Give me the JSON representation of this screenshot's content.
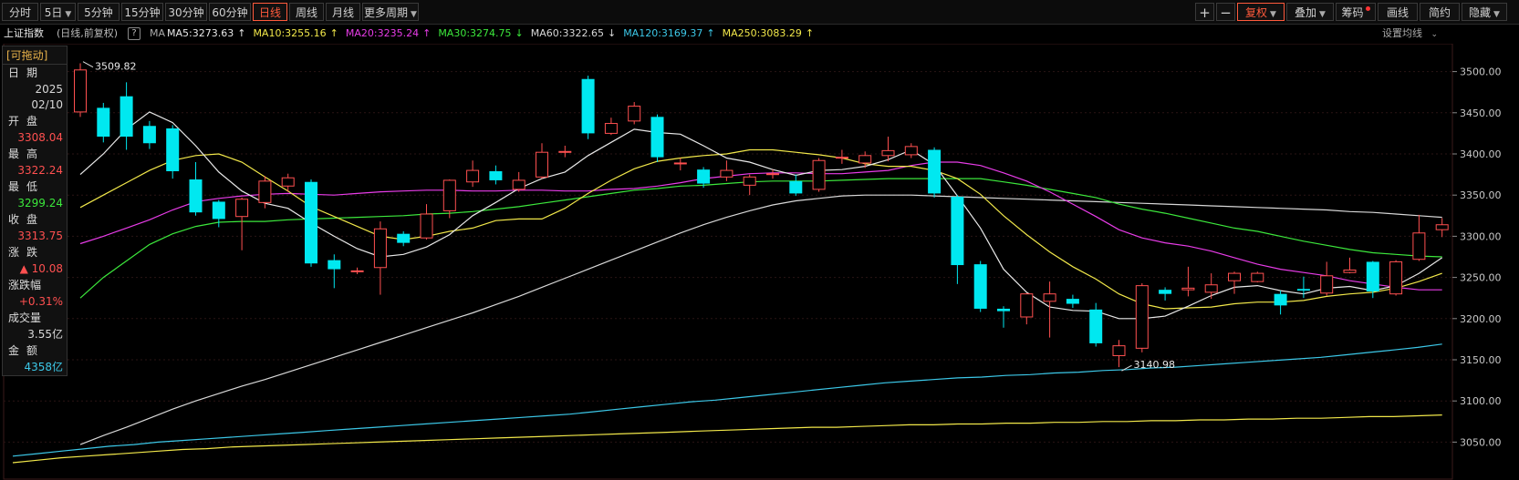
{
  "toolbar": {
    "left_tabs": [
      {
        "label": "分时",
        "active": false,
        "dropdown": false
      },
      {
        "label": "5日",
        "active": false,
        "dropdown": true
      },
      {
        "label": "5分钟",
        "active": false,
        "dropdown": false
      },
      {
        "label": "15分钟",
        "active": false,
        "dropdown": false
      },
      {
        "label": "30分钟",
        "active": false,
        "dropdown": false
      },
      {
        "label": "60分钟",
        "active": false,
        "dropdown": false
      },
      {
        "label": "日线",
        "active": true,
        "dropdown": false
      },
      {
        "label": "周线",
        "active": false,
        "dropdown": false
      },
      {
        "label": "月线",
        "active": false,
        "dropdown": false
      },
      {
        "label": "更多周期",
        "active": false,
        "dropdown": true
      }
    ],
    "zoom_in": "+",
    "zoom_out": "−",
    "right_buttons": [
      {
        "label": "复权",
        "active": true,
        "dropdown": true,
        "dot": false
      },
      {
        "label": "叠加",
        "active": false,
        "dropdown": true,
        "dot": false
      },
      {
        "label": "筹码",
        "active": false,
        "dropdown": false,
        "dot": true
      },
      {
        "label": "画线",
        "active": false,
        "dropdown": false,
        "dot": false
      },
      {
        "label": "简约",
        "active": false,
        "dropdown": false,
        "dot": false
      },
      {
        "label": "隐藏",
        "active": false,
        "dropdown": true,
        "dot": false
      }
    ]
  },
  "info": {
    "index_name": "上证指数",
    "mode": "(日线,前复权)",
    "help": "?",
    "ma_label": "MA",
    "settings": "设置均线"
  },
  "ma_legend": [
    {
      "text": "MA5:3273.63",
      "color": "#e8e8e8",
      "arrow": "↑",
      "arrow_color": "#e8e8e8"
    },
    {
      "text": "MA10:3255.16",
      "color": "#f2e84a",
      "arrow": "↑",
      "arrow_color": "#f2e84a"
    },
    {
      "text": "MA20:3235.24",
      "color": "#e83ce8",
      "arrow": "↑",
      "arrow_color": "#e83ce8"
    },
    {
      "text": "MA30:3274.75",
      "color": "#3ce83c",
      "arrow": "↓",
      "arrow_color": "#3ce83c"
    },
    {
      "text": "MA60:3322.65",
      "color": "#d8d8d8",
      "arrow": "↓",
      "arrow_color": "#d8d8d8"
    },
    {
      "text": "MA120:3169.37",
      "color": "#3cc8e8",
      "arrow": "↑",
      "arrow_color": "#3cc8e8"
    },
    {
      "text": "MA250:3083.29",
      "color": "#f2e84a",
      "arrow": "↑",
      "arrow_color": "#f2e84a"
    }
  ],
  "panel": {
    "header": "[可拖动]",
    "rows": [
      {
        "label": "日期",
        "value": "2025",
        "value2": "02/10",
        "color": "#d8d8d8"
      },
      {
        "label": "开盘",
        "value": "3308.04",
        "color": "#ff5050"
      },
      {
        "label": "最高",
        "value": "3322.24",
        "color": "#ff5050"
      },
      {
        "label": "最低",
        "value": "3299.24",
        "color": "#3ce83c"
      },
      {
        "label": "收盘",
        "value": "3313.75",
        "color": "#ff5050"
      },
      {
        "label": "涨跌",
        "value": "▲ 10.08",
        "color": "#ff5050"
      },
      {
        "label": "涨跌幅",
        "value": "+0.31%",
        "color": "#ff5050",
        "tight": true
      },
      {
        "label": "成交量",
        "value": "3.55亿",
        "color": "#d8d8d8",
        "tight": true
      },
      {
        "label": "金额",
        "value": "4358亿",
        "color": "#3cc8e8"
      }
    ]
  },
  "colors": {
    "up": "#ff5050",
    "down": "#00e8f0",
    "grid": "#2a1414",
    "axis_text": "#c8c8c8",
    "ma5": "#e8e8e8",
    "ma10": "#f2e84a",
    "ma20": "#e83ce8",
    "ma30": "#3ce83c",
    "ma60": "#d8d8d8",
    "ma120": "#3cc8e8",
    "ma250": "#f2e84a"
  },
  "chart_data": {
    "type": "candlestick",
    "ylim": [
      3025,
      3525
    ],
    "y_ticks": [
      3050,
      3100,
      3150,
      3200,
      3250,
      3300,
      3350,
      3400,
      3450,
      3500
    ],
    "y_tick_labels": [
      "3050.00",
      "3100.00",
      "3150.00",
      "3200.00",
      "3250.00",
      "3300.00",
      "3350.00",
      "3400.00",
      "3450.00",
      "3500.00"
    ],
    "annotations": [
      {
        "text": "3509.82",
        "index": 0,
        "value": 3509.82
      },
      {
        "text": "3140.98",
        "index": 45,
        "value": 3140.98
      }
    ],
    "candles": [
      {
        "o": 3451,
        "c": 3502,
        "h": 3510,
        "l": 3445
      },
      {
        "o": 3456,
        "c": 3421,
        "h": 3462,
        "l": 3414
      },
      {
        "o": 3470,
        "c": 3421,
        "h": 3487,
        "l": 3405
      },
      {
        "o": 3434,
        "c": 3413,
        "h": 3440,
        "l": 3406
      },
      {
        "o": 3431,
        "c": 3379,
        "h": 3435,
        "l": 3370
      },
      {
        "o": 3369,
        "c": 3329,
        "h": 3390,
        "l": 3325
      },
      {
        "o": 3342,
        "c": 3321,
        "h": 3344,
        "l": 3311
      },
      {
        "o": 3324,
        "c": 3345,
        "h": 3347,
        "l": 3283
      },
      {
        "o": 3341,
        "c": 3367,
        "h": 3373,
        "l": 3334
      },
      {
        "o": 3361,
        "c": 3371,
        "h": 3376,
        "l": 3354
      },
      {
        "o": 3366,
        "c": 3267,
        "h": 3369,
        "l": 3263
      },
      {
        "o": 3271,
        "c": 3260,
        "h": 3278,
        "l": 3237
      },
      {
        "o": 3258,
        "c": 3258,
        "h": 3262,
        "l": 3254
      },
      {
        "o": 3262,
        "c": 3309,
        "h": 3318,
        "l": 3229
      },
      {
        "o": 3303,
        "c": 3292,
        "h": 3306,
        "l": 3288
      },
      {
        "o": 3298,
        "c": 3327,
        "h": 3339,
        "l": 3296
      },
      {
        "o": 3331,
        "c": 3368,
        "h": 3369,
        "l": 3322
      },
      {
        "o": 3366,
        "c": 3380,
        "h": 3392,
        "l": 3360
      },
      {
        "o": 3379,
        "c": 3368,
        "h": 3386,
        "l": 3363
      },
      {
        "o": 3357,
        "c": 3368,
        "h": 3378,
        "l": 3354
      },
      {
        "o": 3372,
        "c": 3402,
        "h": 3413,
        "l": 3370
      },
      {
        "o": 3403,
        "c": 3403,
        "h": 3410,
        "l": 3396
      },
      {
        "o": 3491,
        "c": 3425,
        "h": 3495,
        "l": 3418
      },
      {
        "o": 3425,
        "c": 3437,
        "h": 3444,
        "l": 3423
      },
      {
        "o": 3440,
        "c": 3458,
        "h": 3463,
        "l": 3436
      },
      {
        "o": 3445,
        "c": 3396,
        "h": 3448,
        "l": 3390
      },
      {
        "o": 3389,
        "c": 3389,
        "h": 3395,
        "l": 3380
      },
      {
        "o": 3381,
        "c": 3364,
        "h": 3384,
        "l": 3359
      },
      {
        "o": 3372,
        "c": 3380,
        "h": 3392,
        "l": 3367
      },
      {
        "o": 3362,
        "c": 3372,
        "h": 3375,
        "l": 3350
      },
      {
        "o": 3376,
        "c": 3376,
        "h": 3381,
        "l": 3370
      },
      {
        "o": 3367,
        "c": 3352,
        "h": 3375,
        "l": 3349
      },
      {
        "o": 3357,
        "c": 3392,
        "h": 3395,
        "l": 3354
      },
      {
        "o": 3396,
        "c": 3396,
        "h": 3405,
        "l": 3388
      },
      {
        "o": 3389,
        "c": 3398,
        "h": 3403,
        "l": 3383
      },
      {
        "o": 3398,
        "c": 3404,
        "h": 3421,
        "l": 3391
      },
      {
        "o": 3399,
        "c": 3409,
        "h": 3413,
        "l": 3395
      },
      {
        "o": 3405,
        "c": 3352,
        "h": 3408,
        "l": 3347
      },
      {
        "o": 3348,
        "c": 3265,
        "h": 3350,
        "l": 3242
      },
      {
        "o": 3266,
        "c": 3212,
        "h": 3270,
        "l": 3208
      },
      {
        "o": 3212,
        "c": 3209,
        "h": 3215,
        "l": 3189
      },
      {
        "o": 3202,
        "c": 3230,
        "h": 3231,
        "l": 3193
      },
      {
        "o": 3221,
        "c": 3230,
        "h": 3245,
        "l": 3177
      },
      {
        "o": 3224,
        "c": 3218,
        "h": 3229,
        "l": 3213
      },
      {
        "o": 3211,
        "c": 3170,
        "h": 3219,
        "l": 3166
      },
      {
        "o": 3155,
        "c": 3167,
        "h": 3174,
        "l": 3141
      },
      {
        "o": 3164,
        "c": 3240,
        "h": 3243,
        "l": 3159
      },
      {
        "o": 3235,
        "c": 3230,
        "h": 3238,
        "l": 3222
      },
      {
        "o": 3235,
        "c": 3237,
        "h": 3263,
        "l": 3227
      },
      {
        "o": 3232,
        "c": 3241,
        "h": 3255,
        "l": 3224
      },
      {
        "o": 3246,
        "c": 3255,
        "h": 3257,
        "l": 3230
      },
      {
        "o": 3245,
        "c": 3255,
        "h": 3257,
        "l": 3244
      },
      {
        "o": 3230,
        "c": 3216,
        "h": 3234,
        "l": 3205
      },
      {
        "o": 3236,
        "c": 3234,
        "h": 3251,
        "l": 3225
      },
      {
        "o": 3231,
        "c": 3252,
        "h": 3269,
        "l": 3228
      },
      {
        "o": 3256,
        "c": 3259,
        "h": 3274,
        "l": 3255
      },
      {
        "o": 3269,
        "c": 3233,
        "h": 3270,
        "l": 3225
      },
      {
        "o": 3230,
        "c": 3269,
        "h": 3271,
        "l": 3228
      },
      {
        "o": 3272,
        "c": 3304,
        "h": 3326,
        "l": 3270
      },
      {
        "o": 3308,
        "c": 3314,
        "h": 3322,
        "l": 3299
      }
    ],
    "ma5": [
      3375,
      3400,
      3430,
      3451,
      3438,
      3410,
      3378,
      3355,
      3340,
      3334,
      3316,
      3300,
      3285,
      3275,
      3278,
      3287,
      3302,
      3325,
      3341,
      3358,
      3370,
      3378,
      3398,
      3414,
      3430,
      3426,
      3424,
      3410,
      3395,
      3390,
      3381,
      3374,
      3380,
      3381,
      3385,
      3393,
      3405,
      3387,
      3349,
      3310,
      3260,
      3232,
      3214,
      3210,
      3209,
      3200,
      3200,
      3203,
      3215,
      3228,
      3238,
      3240,
      3234,
      3230,
      3237,
      3239,
      3234,
      3240,
      3255,
      3274
    ],
    "ma10": [
      3335,
      3350,
      3365,
      3380,
      3392,
      3398,
      3400,
      3390,
      3372,
      3355,
      3336,
      3324,
      3312,
      3300,
      3296,
      3300,
      3306,
      3310,
      3319,
      3321,
      3321,
      3334,
      3352,
      3368,
      3382,
      3391,
      3395,
      3398,
      3400,
      3405,
      3405,
      3402,
      3399,
      3395,
      3388,
      3385,
      3385,
      3380,
      3370,
      3351,
      3325,
      3302,
      3281,
      3263,
      3248,
      3230,
      3218,
      3212,
      3213,
      3214,
      3218,
      3220,
      3220,
      3222,
      3227,
      3230,
      3232,
      3237,
      3245,
      3255
    ],
    "ma20": [
      3291,
      3300,
      3310,
      3320,
      3332,
      3342,
      3346,
      3349,
      3351,
      3352,
      3351,
      3350,
      3352,
      3354,
      3355,
      3356,
      3356,
      3355,
      3355,
      3356,
      3356,
      3355,
      3355,
      3357,
      3358,
      3361,
      3365,
      3370,
      3373,
      3376,
      3377,
      3377,
      3376,
      3376,
      3378,
      3380,
      3386,
      3390,
      3390,
      3386,
      3377,
      3367,
      3354,
      3339,
      3324,
      3308,
      3298,
      3292,
      3288,
      3282,
      3274,
      3266,
      3260,
      3256,
      3252,
      3246,
      3242,
      3238,
      3235,
      3235
    ],
    "ma30": [
      3225,
      3250,
      3270,
      3290,
      3303,
      3312,
      3317,
      3318,
      3318,
      3320,
      3321,
      3322,
      3323,
      3324,
      3325,
      3327,
      3328,
      3330,
      3333,
      3336,
      3340,
      3344,
      3348,
      3352,
      3356,
      3358,
      3361,
      3362,
      3364,
      3366,
      3367,
      3367,
      3367,
      3368,
      3369,
      3370,
      3370,
      3370,
      3370,
      3370,
      3366,
      3362,
      3357,
      3352,
      3347,
      3339,
      3333,
      3328,
      3322,
      3316,
      3310,
      3306,
      3300,
      3294,
      3289,
      3284,
      3280,
      3278,
      3276,
      3275
    ],
    "ma60": [
      3047,
      3058,
      3068,
      3079,
      3090,
      3100,
      3109,
      3118,
      3126,
      3135,
      3144,
      3153,
      3162,
      3171,
      3180,
      3189,
      3198,
      3207,
      3217,
      3227,
      3238,
      3249,
      3260,
      3271,
      3282,
      3293,
      3304,
      3314,
      3323,
      3331,
      3338,
      3343,
      3346,
      3349,
      3350,
      3350,
      3350,
      3349,
      3348,
      3347,
      3346,
      3345,
      3344,
      3343,
      3342,
      3341,
      3340,
      3339,
      3338,
      3337,
      3336,
      3335,
      3334,
      3333,
      3332,
      3330,
      3329,
      3327,
      3325,
      3323
    ],
    "ma120": [
      3033,
      3036,
      3039,
      3042,
      3045,
      3047,
      3050,
      3052,
      3054,
      3056,
      3058,
      3060,
      3062,
      3064,
      3066,
      3068,
      3070,
      3072,
      3074,
      3076,
      3078,
      3080,
      3082,
      3084,
      3087,
      3090,
      3093,
      3096,
      3099,
      3101,
      3104,
      3107,
      3110,
      3113,
      3116,
      3119,
      3122,
      3124,
      3126,
      3128,
      3129,
      3131,
      3132,
      3134,
      3135,
      3137,
      3138,
      3140,
      3141,
      3143,
      3145,
      3147,
      3149,
      3151,
      3153,
      3156,
      3159,
      3162,
      3165,
      3169
    ],
    "ma250": [
      3025,
      3028,
      3031,
      3033,
      3035,
      3037,
      3039,
      3041,
      3042,
      3044,
      3045,
      3046,
      3047,
      3048,
      3049,
      3050,
      3051,
      3052,
      3053,
      3054,
      3055,
      3056,
      3057,
      3058,
      3059,
      3060,
      3061,
      3062,
      3063,
      3064,
      3065,
      3066,
      3067,
      3068,
      3068,
      3069,
      3070,
      3071,
      3071,
      3072,
      3072,
      3073,
      3073,
      3074,
      3074,
      3075,
      3075,
      3076,
      3076,
      3077,
      3077,
      3078,
      3078,
      3079,
      3079,
      3080,
      3081,
      3081,
      3082,
      3083
    ]
  }
}
